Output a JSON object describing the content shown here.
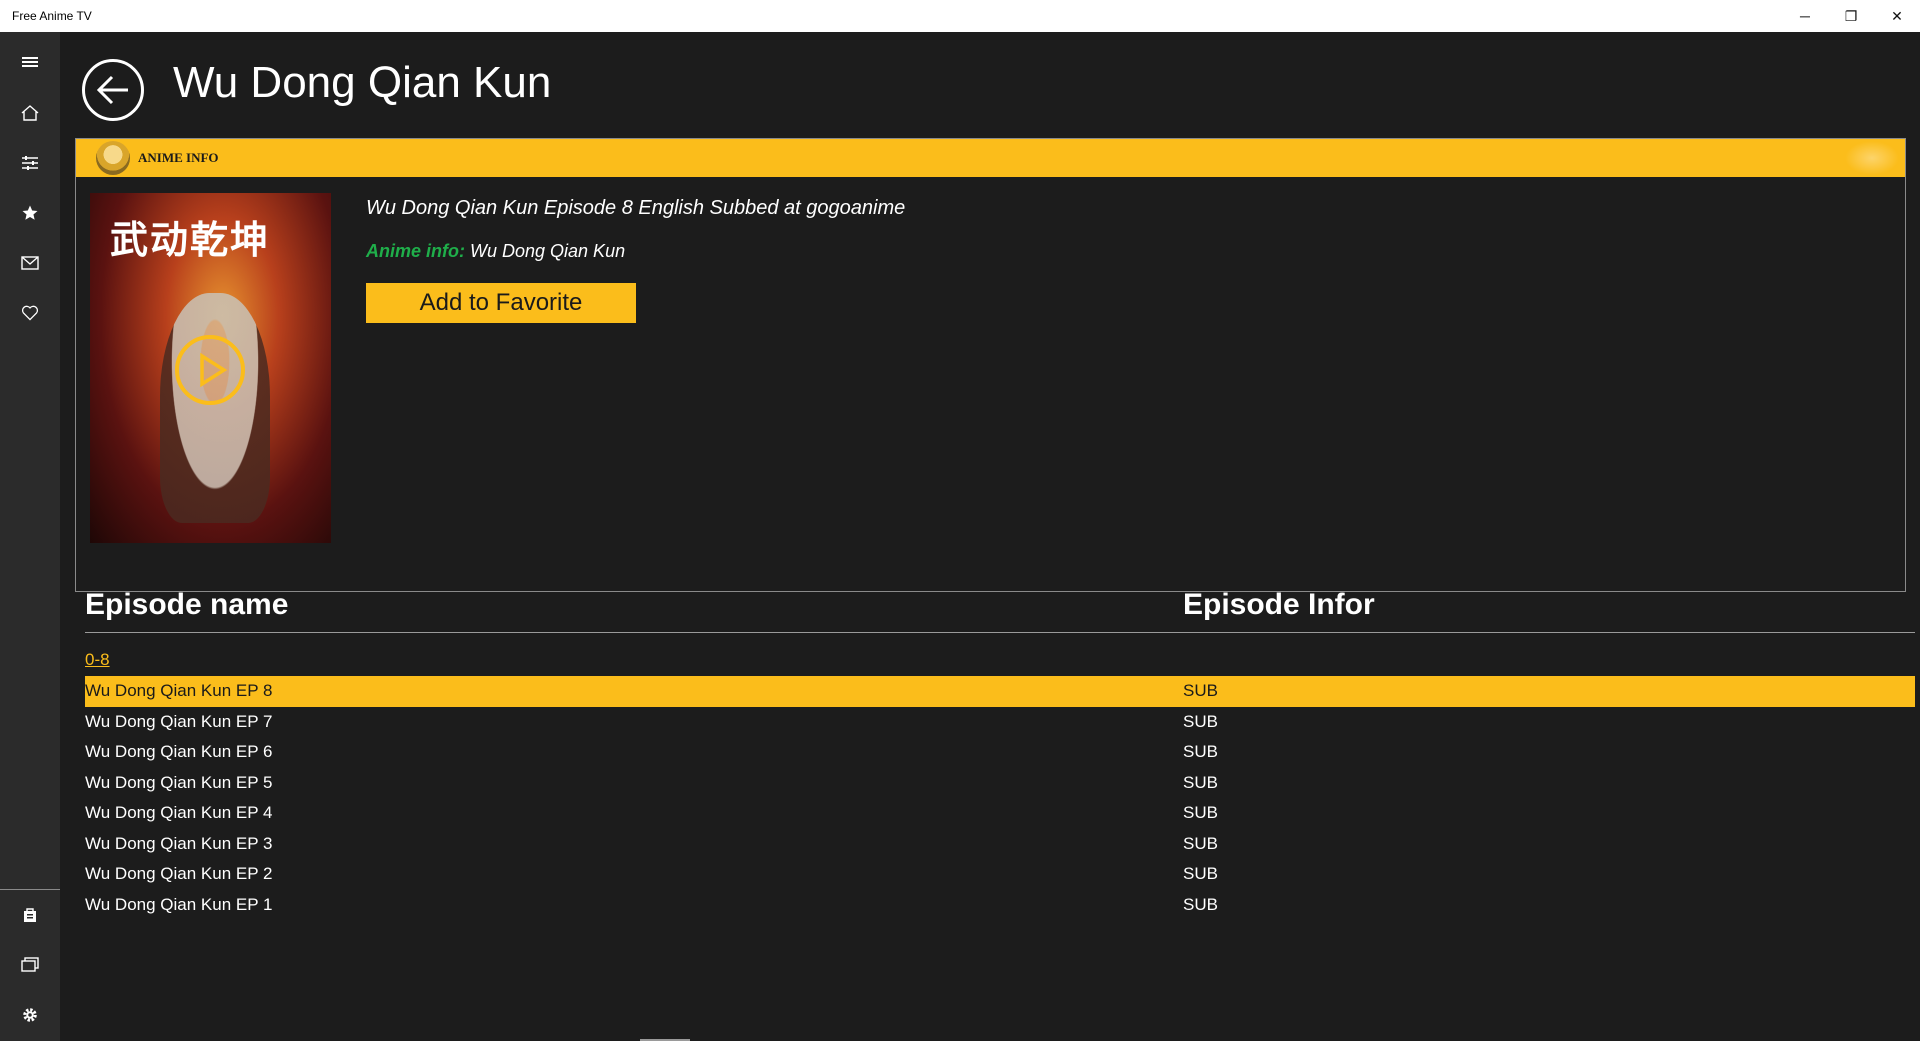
{
  "window": {
    "title": "Free Anime TV",
    "minimize": "─",
    "restore": "❐",
    "close": "✕"
  },
  "sidebar": {
    "items": [
      {
        "icon": "hamburger-icon",
        "glyph": "≡"
      },
      {
        "icon": "home-icon",
        "glyph": "⌂"
      },
      {
        "icon": "filter-icon",
        "glyph": "☰"
      },
      {
        "icon": "star-icon",
        "glyph": "★"
      },
      {
        "icon": "mail-icon",
        "glyph": "✉"
      },
      {
        "icon": "heart-icon",
        "glyph": "♡"
      }
    ],
    "bottom_items": [
      {
        "icon": "bag-icon"
      },
      {
        "icon": "windows-icon"
      },
      {
        "icon": "gear-icon",
        "glyph": "⚙"
      }
    ]
  },
  "header": {
    "title": "Wu Dong Qian Kun"
  },
  "info_panel": {
    "header_label": "ANIME INFO",
    "poster_text": "武动乾坤",
    "headline": "Wu Dong Qian Kun Episode 8 English Subbed at gogoanime",
    "anime_info_label": "Anime info:",
    "anime_info_value": " Wu Dong Qian Kun",
    "favorite_button": "Add to Favorite"
  },
  "episodes": {
    "col_name": "Episode name",
    "col_info": "Episode Infor",
    "range": "0-8",
    "rows": [
      {
        "name": "Wu Dong Qian Kun EP 8",
        "info": "SUB",
        "selected": true
      },
      {
        "name": "Wu Dong Qian Kun EP 7",
        "info": "SUB"
      },
      {
        "name": "Wu Dong Qian Kun EP 6",
        "info": "SUB"
      },
      {
        "name": "Wu Dong Qian Kun EP 5",
        "info": "SUB"
      },
      {
        "name": "Wu Dong Qian Kun EP 4",
        "info": "SUB"
      },
      {
        "name": "Wu Dong Qian Kun EP 3",
        "info": "SUB"
      },
      {
        "name": "Wu Dong Qian Kun EP 2",
        "info": "SUB"
      },
      {
        "name": "Wu Dong Qian Kun EP 1",
        "info": "SUB"
      }
    ]
  },
  "colors": {
    "accent": "#fbbd1b",
    "background": "#1c1c1c",
    "sidebar": "#2b2b2b",
    "info_label_green": "#1fae4a"
  }
}
